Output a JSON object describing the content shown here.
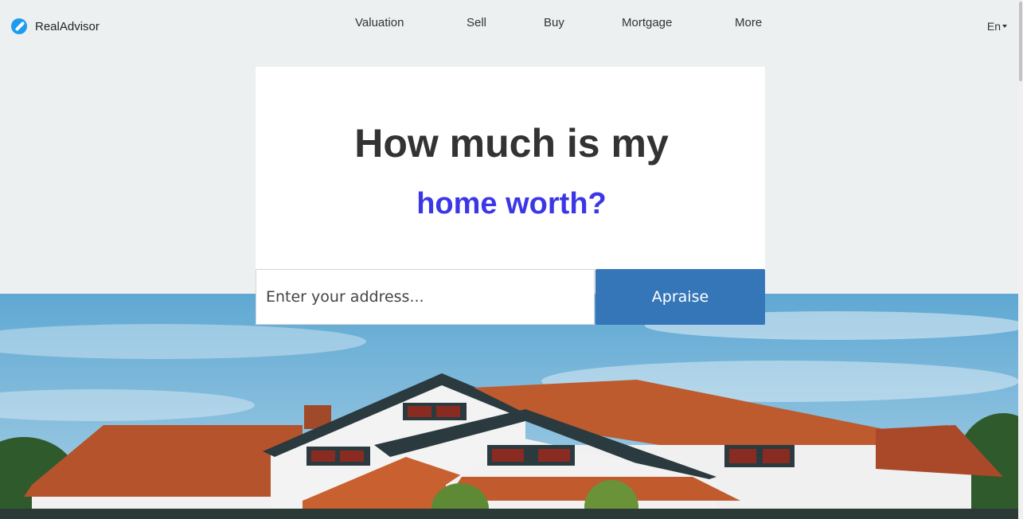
{
  "brand": {
    "name": "RealAdvisor",
    "logo_icon": "realadvisor-logo-icon",
    "color": "#1e9bf0"
  },
  "nav": {
    "items": [
      {
        "label": "Valuation"
      },
      {
        "label": "Sell"
      },
      {
        "label": "Buy"
      },
      {
        "label": "Mortgage"
      },
      {
        "label": "More"
      }
    ],
    "language": "En"
  },
  "hero": {
    "title": "How much is my",
    "subtitle": "home worth?",
    "subtitle_color": "#3b37e6",
    "background": "house-photo-blue-sky"
  },
  "search": {
    "placeholder": "Enter your address...",
    "value": "",
    "button_label": "Apraise",
    "button_color": "#3476b8"
  }
}
